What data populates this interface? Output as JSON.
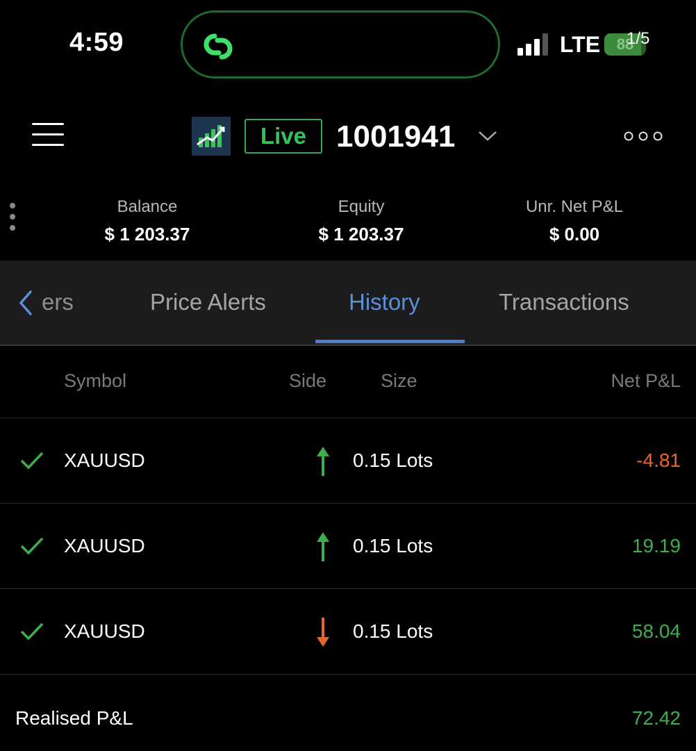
{
  "status_bar": {
    "time": "4:59",
    "network": "LTE",
    "battery": "88",
    "battery_level": 0.88,
    "page_counter": "1/5"
  },
  "header": {
    "badge": "Live",
    "account_number": "1001941"
  },
  "summary": {
    "balance_label": "Balance",
    "balance_value": "$ 1 203.37",
    "equity_label": "Equity",
    "equity_value": "$ 1 203.37",
    "unr_label": "Unr. Net P&L",
    "unr_value": "$ 0.00"
  },
  "tabs": {
    "partial": "ers",
    "price_alerts": "Price Alerts",
    "history": "History",
    "transactions": "Transactions"
  },
  "table": {
    "columns": {
      "symbol": "Symbol",
      "side": "Side",
      "size": "Size",
      "net_pnl": "Net P&L"
    },
    "rows": [
      {
        "symbol": "XAUUSD",
        "side": "up",
        "size": "0.15 Lots",
        "net_pnl": "-4.81"
      },
      {
        "symbol": "XAUUSD",
        "side": "up",
        "size": "0.15 Lots",
        "net_pnl": "19.19"
      },
      {
        "symbol": "XAUUSD",
        "side": "down",
        "size": "0.15 Lots",
        "net_pnl": "58.04"
      }
    ]
  },
  "realised": {
    "label": "Realised P&L",
    "value": "72.42"
  },
  "colors": {
    "positive": "#3fae4f",
    "negative": "#e8662e",
    "accent": "#5b8fd6"
  }
}
